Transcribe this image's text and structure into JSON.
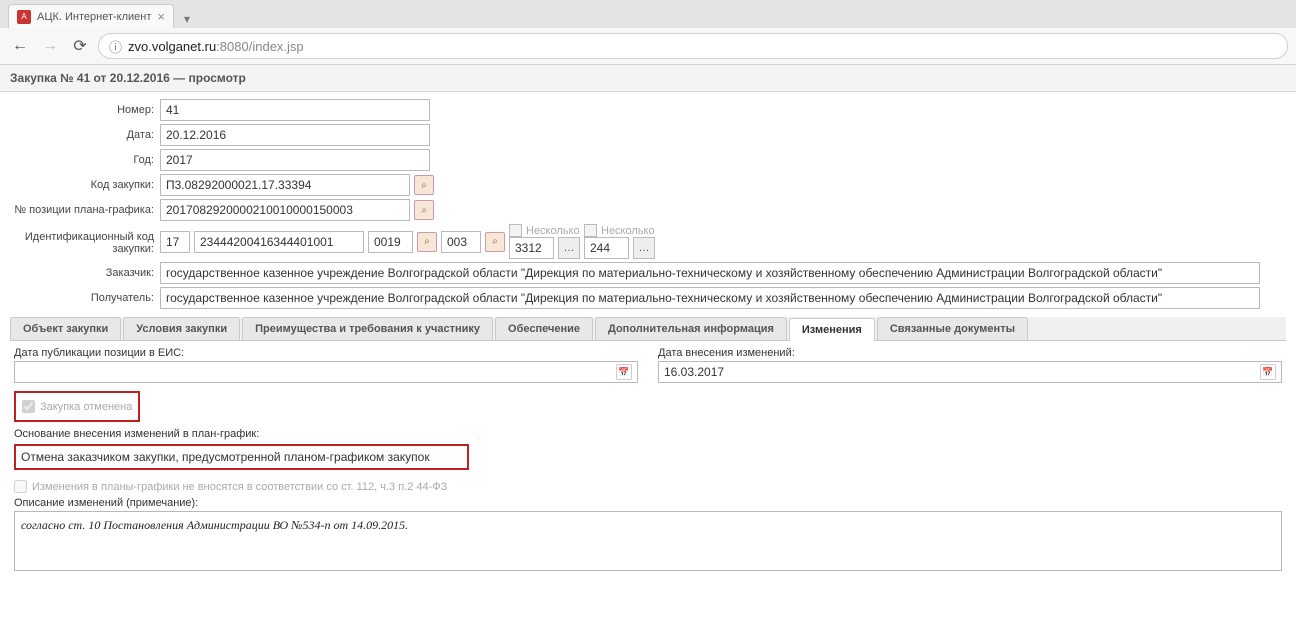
{
  "browser": {
    "tab_title": "АЦК. Интернет-клиент",
    "url_host": "zvo.volganet.ru",
    "url_port": ":8080",
    "url_path": "/index.jsp"
  },
  "page_title": "Закупка № 41 от 20.12.2016 — просмотр",
  "form": {
    "nomer_label": "Номер:",
    "nomer": "41",
    "data_label": "Дата:",
    "data": "20.12.2016",
    "god_label": "Год:",
    "god": "2017",
    "kod_zakupki_label": "Код закупки:",
    "kod_zakupki": "П3.08292000021.17.33394",
    "poz_plan_label": "№ позиции плана-графика:",
    "poz_plan": "2017082920000210010000150003",
    "ikz_label": "Идентификационный код закупки:",
    "neskolko1": "Несколько",
    "neskolko2": "Несколько",
    "ikz_1": "17",
    "ikz_2": "23444200416344401001",
    "ikz_3": "0019",
    "ikz_4": "003",
    "ikz_5": "3312",
    "ikz_6": "244",
    "zakazchik_label": "Заказчик:",
    "zakazchik": "государственное казенное учреждение Волгоградской области \"Дирекция по материально-техническому и хозяйственному обеспечению Администрации Волгоградской области\"",
    "poluchatel_label": "Получатель:",
    "poluchatel": "государственное казенное учреждение Волгоградской области \"Дирекция по материально-техническому и хозяйственному обеспечению Администрации Волгоградской области\""
  },
  "tabs": {
    "t1": "Объект закупки",
    "t2": "Условия закупки",
    "t3": "Преимущества и требования к участнику",
    "t4": "Обеспечение",
    "t5": "Дополнительная информация",
    "t6": "Изменения",
    "t7": "Связанные документы"
  },
  "changes": {
    "pub_label": "Дата публикации позиции в ЕИС:",
    "pub_value": "",
    "chg_date_label": "Дата внесения изменений:",
    "chg_date": "16.03.2017",
    "cancelled": "Закупка отменена",
    "osnovanie_label": "Основание внесения изменений в план-график:",
    "osnovanie": "Отмена заказчиком закупки, предусмотренной планом-графиком закупок",
    "plan_not_changed": "Изменения в планы-графики не вносятся в соответствии со ст. 112, ч.3 п.2 44-ФЗ",
    "desc_label": "Описание изменений (примечание):",
    "desc": "согласно ст. 10 Постановления Администрации ВО №534-п от 14.09.2015."
  }
}
